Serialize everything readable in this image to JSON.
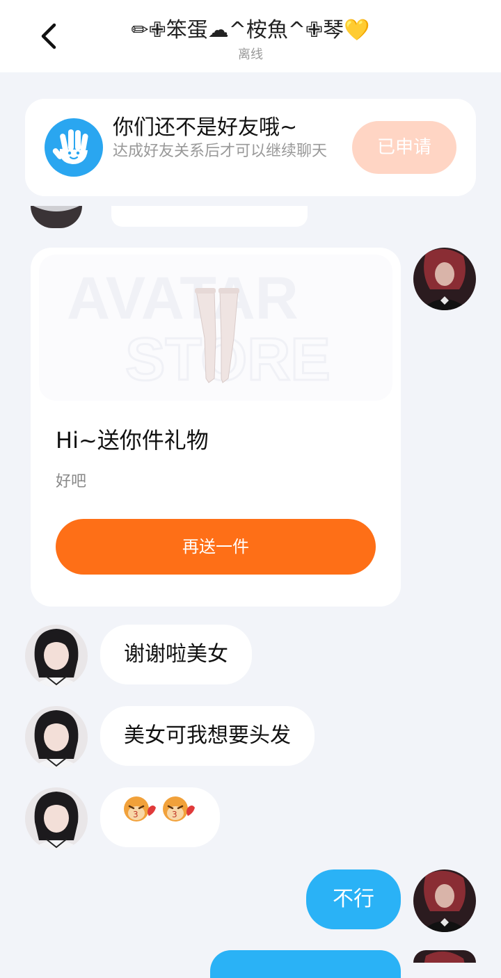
{
  "header": {
    "title": "✏✙笨蛋☁^桉魚^✙琴💛",
    "status": "离线"
  },
  "notice": {
    "title": "你们还不是好友哦~",
    "desc": "达成好友关系后才可以继续聊天",
    "apply_label": "已申请",
    "colors": {
      "icon": "#2aa6f0",
      "button": "#ffd5c4"
    }
  },
  "gift_card": {
    "title": "Hi~送你件礼物",
    "subtitle": "好吧",
    "button_label": "再送一件",
    "watermark": [
      "AVATAR",
      "STORE"
    ],
    "button_color": "#fe6f17"
  },
  "messages": [
    {
      "side": "left",
      "text": "谢谢啦美女"
    },
    {
      "side": "left",
      "text": "美女可我想要头发"
    },
    {
      "side": "left",
      "emoji": "monkey-kiss-face"
    },
    {
      "side": "right",
      "text": "不行"
    }
  ],
  "colors": {
    "my_bubble": "#2ab2f6",
    "background": "#f2f4f9"
  }
}
